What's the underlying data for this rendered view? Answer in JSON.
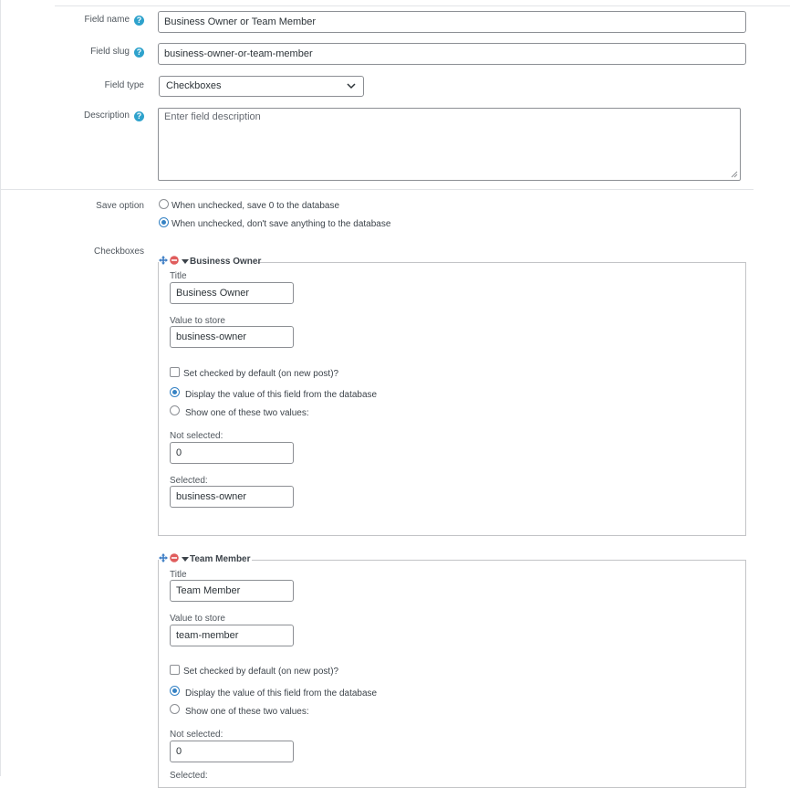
{
  "field_name": {
    "label": "Field name",
    "value": "Business Owner or Team Member"
  },
  "field_slug": {
    "label": "Field slug",
    "value": "business-owner-or-team-member"
  },
  "field_type": {
    "label": "Field type",
    "value": "Checkboxes"
  },
  "description": {
    "label": "Description",
    "placeholder": "Enter field description"
  },
  "save_option": {
    "label": "Save option",
    "options": [
      {
        "label": "When unchecked, save 0 to the database",
        "selected": false
      },
      {
        "label": "When unchecked, don't save anything to the database",
        "selected": true
      }
    ]
  },
  "checkboxes_label": "Checkboxes",
  "help_glyph": "?",
  "checkboxes": [
    {
      "legend": "Business Owner",
      "title_label": "Title",
      "title_value": "Business Owner",
      "value_label": "Value to store",
      "value_value": "business-owner",
      "default_label": "Set checked by default (on new post)?",
      "display_label": "Display the value of this field from the database",
      "show_label": "Show one of these two values:",
      "not_selected_label": "Not selected:",
      "not_selected_value": "0",
      "selected_label": "Selected:",
      "selected_value": "business-owner"
    },
    {
      "legend": "Team Member",
      "title_label": "Title",
      "title_value": "Team Member",
      "value_label": "Value to store",
      "value_value": "team-member",
      "default_label": "Set checked by default (on new post)?",
      "display_label": "Display the value of this field from the database",
      "show_label": "Show one of these two values:",
      "not_selected_label": "Not selected:",
      "not_selected_value": "0",
      "selected_label": "Selected:"
    }
  ],
  "colors": {
    "accent": "#3582c4",
    "help": "#2ea2cc",
    "remove": "#e05d5d",
    "move": "#3b7cc4"
  }
}
